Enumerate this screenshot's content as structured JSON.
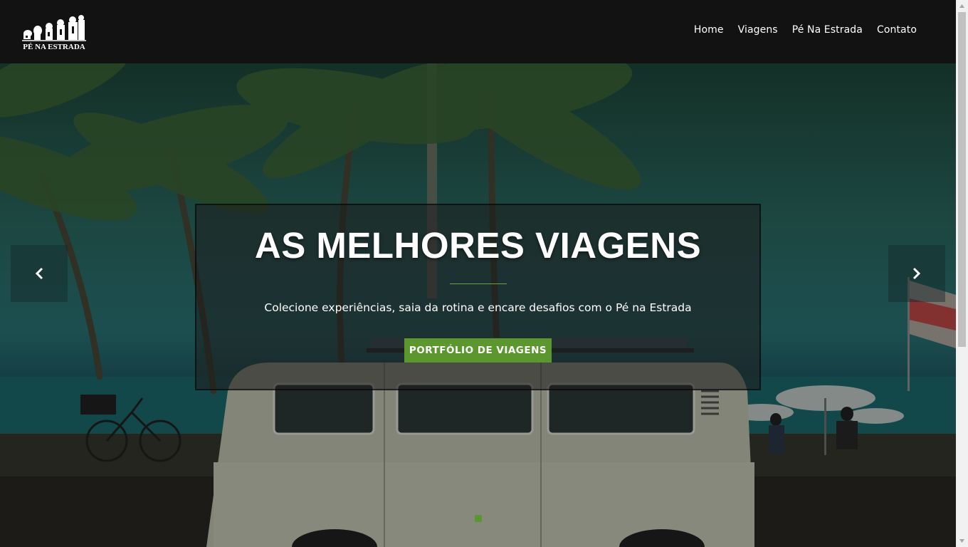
{
  "nav": {
    "logo_text": "PÉ NA ESTRADA",
    "links": [
      "Home",
      "Viagens",
      "Pé Na Estrada",
      "Contato"
    ]
  },
  "hero": {
    "title": "AS MELHORES VIAGENS",
    "subtitle": "Colecione experiências, saia da rotina e encare desafios com o Pé na Estrada",
    "cta_label": "PORTFÓLIO DE VIAGENS",
    "prev_icon": "chevron-left-icon",
    "next_icon": "chevron-right-icon",
    "slide_count": 1,
    "active_slide": 1
  },
  "colors": {
    "navbar_bg": "#121212",
    "accent_green": "#5b962f",
    "text": "#ffffff"
  }
}
